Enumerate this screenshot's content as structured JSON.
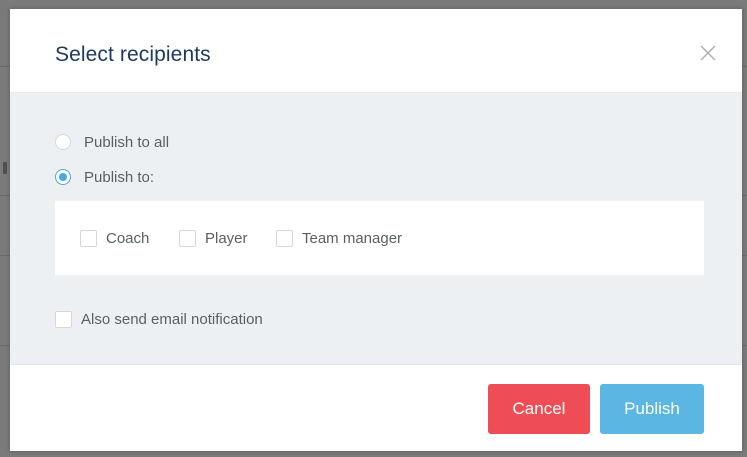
{
  "modal": {
    "title": "Select recipients",
    "close_icon": "close-icon"
  },
  "publish_options": [
    {
      "label": "Publish to all",
      "selected": false
    },
    {
      "label": "Publish to:",
      "selected": true
    }
  ],
  "roles": [
    {
      "label": "Coach",
      "checked": false
    },
    {
      "label": "Player",
      "checked": false
    },
    {
      "label": "Team manager",
      "checked": false
    }
  ],
  "email_notification": {
    "label": "Also send email notification",
    "checked": false
  },
  "footer": {
    "cancel_label": "Cancel",
    "publish_label": "Publish"
  },
  "colors": {
    "title": "#1b3a5c",
    "accent": "#4aa8e0",
    "cancel": "#ef4d56",
    "publish": "#5cb6e4",
    "body_bg": "#edf0f3",
    "backdrop": "#7a7a7a"
  }
}
